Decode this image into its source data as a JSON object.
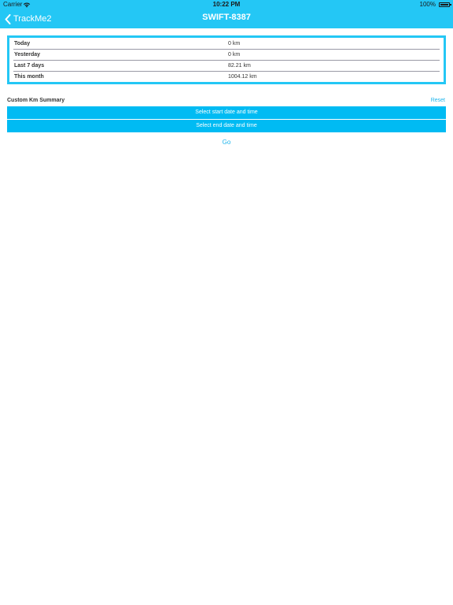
{
  "status_bar": {
    "carrier": "Carrier",
    "time": "10:22 PM",
    "battery": "100%",
    "icons": [
      "wifi-icon",
      "battery-icon"
    ]
  },
  "nav": {
    "back_label": "TrackMe2",
    "title": "SWIFT-8387",
    "back_icon": "chevron-left-icon"
  },
  "summary": {
    "rows": [
      {
        "label": "Today",
        "value": "0 km"
      },
      {
        "label": "Yesterday",
        "value": "0 km"
      },
      {
        "label": "Last 7 days",
        "value": "82.21 km"
      },
      {
        "label": "This month",
        "value": "1004.12 km"
      }
    ]
  },
  "custom": {
    "title": "Custom Km Summary",
    "reset_label": "Reset",
    "start_label": "Select start date and time",
    "end_label": "Select end date and time",
    "go_label": "Go"
  },
  "colors": {
    "accent": "#24c7f5",
    "button": "#00bbf3",
    "link": "#1fb5ec"
  }
}
